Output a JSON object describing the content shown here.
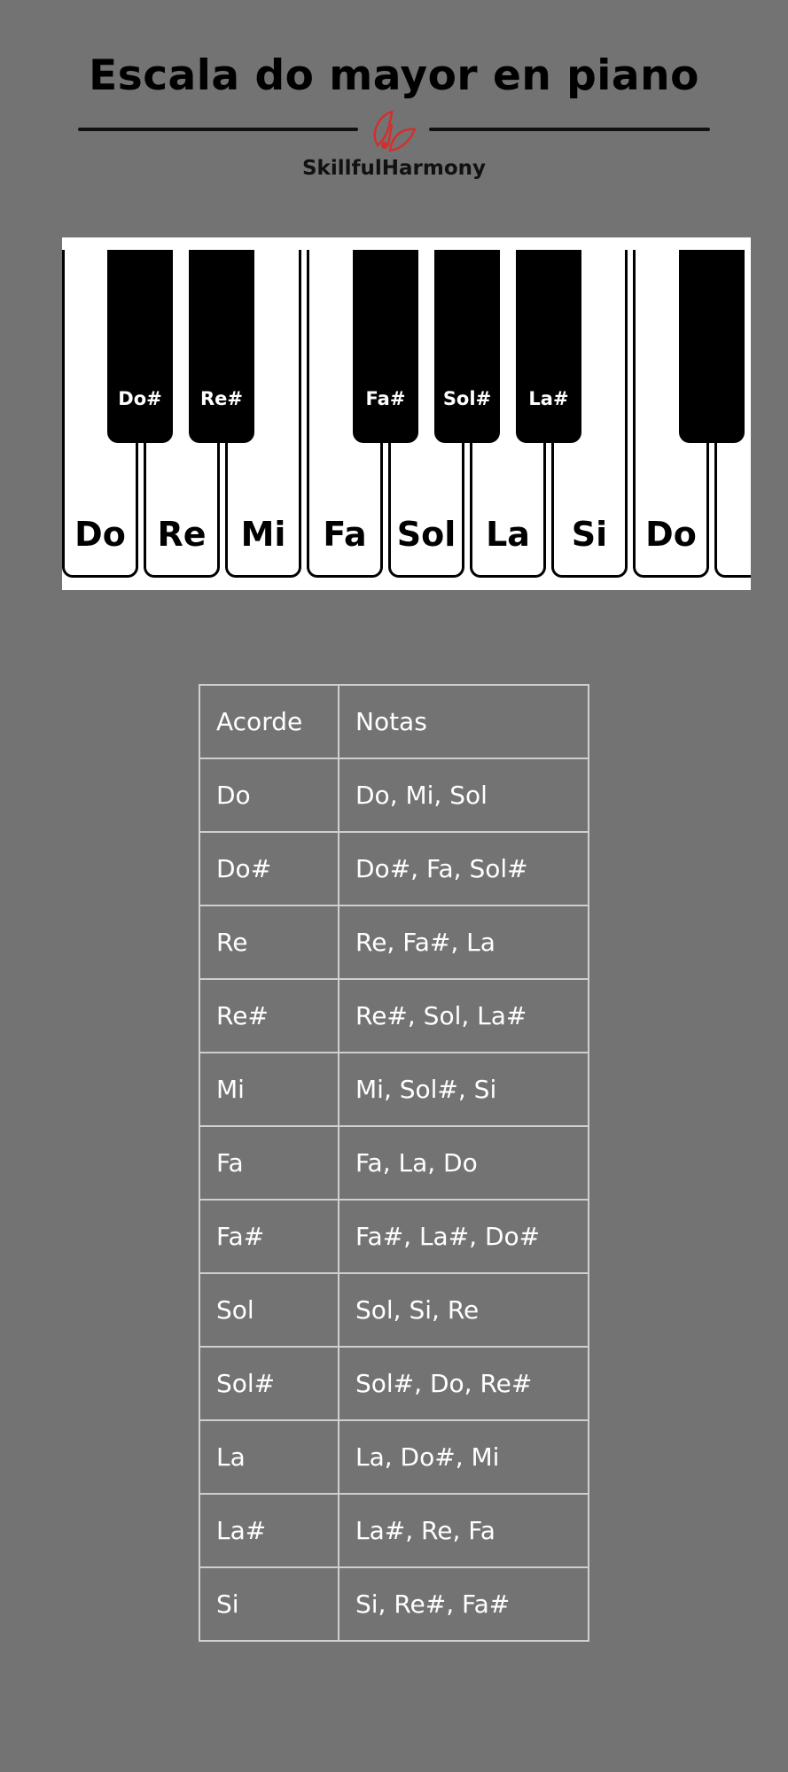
{
  "header": {
    "title": "Escala do mayor en piano",
    "brand": "SkillfulHarmony"
  },
  "piano": {
    "white_keys": [
      "Do",
      "Re",
      "Mi",
      "Fa",
      "Sol",
      "La",
      "Si",
      "Do",
      ""
    ],
    "black_keys": [
      "Do#",
      "Re#",
      "Fa#",
      "Sol#",
      "La#",
      ""
    ]
  },
  "table": {
    "headers": [
      "Acorde",
      "Notas"
    ],
    "rows": [
      [
        "Do",
        "Do, Mi, Sol"
      ],
      [
        "Do#",
        "Do#, Fa, Sol#"
      ],
      [
        "Re",
        "Re, Fa#, La"
      ],
      [
        "Re#",
        "Re#, Sol, La#"
      ],
      [
        "Mi",
        "Mi, Sol#, Si"
      ],
      [
        "Fa",
        "Fa, La, Do"
      ],
      [
        "Fa#",
        "Fa#, La#, Do#"
      ],
      [
        "Sol",
        "Sol, Si, Re"
      ],
      [
        "Sol#",
        "Sol#, Do, Re#"
      ],
      [
        "La",
        "La, Do#, Mi"
      ],
      [
        "La#",
        "La#, Re, Fa"
      ],
      [
        "Si",
        "Si, Re#, Fa#"
      ]
    ]
  }
}
